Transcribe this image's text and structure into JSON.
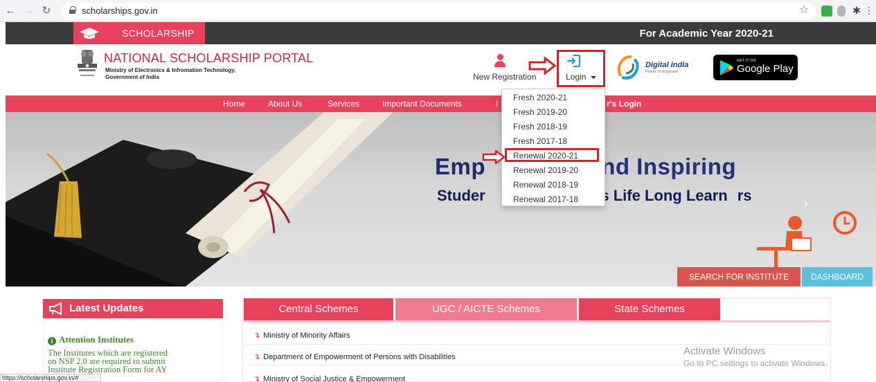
{
  "browser": {
    "url": "scholarships.gov.in",
    "status_url": "https://scholarships.gov.in/#"
  },
  "topbar": {
    "section_label": "SCHOLARSHIP",
    "academic_year": "For Academic Year 2020-21"
  },
  "header": {
    "portal_title": "NATIONAL SCHOLARSHIP PORTAL",
    "ministry_line1": "Ministry of Electronics & Infromation Technology,",
    "ministry_line2": "Government of India",
    "new_registration": "New Registration",
    "login": "Login",
    "digital_india": "Digital India",
    "digital_india_tagline": "Power To Empower",
    "gplay_small": "GET IT ON",
    "gplay_big": "Google Play"
  },
  "nav": {
    "items": [
      "Home",
      "About Us",
      "Services",
      "Important Documents",
      "I",
      "r's Login"
    ]
  },
  "login_dropdown": {
    "items": [
      "Fresh 2020-21",
      "Fresh 2019-20",
      "Fresh 2018-19",
      "Fresh 2017-18",
      "Renewal 2020-21",
      "Renewal 2019-20",
      "Renewal 2018-19",
      "Renewal 2017-18"
    ],
    "highlighted_index": 4
  },
  "hero": {
    "headline_left": "Emp",
    "headline_right": "g and Inspiring",
    "subline_left": "Studer",
    "subline_right": "el as Life Long Learn",
    "subline_end": "rs",
    "search_button": "SEARCH FOR INSTITUTE",
    "dashboard_button": "DASHBOARD"
  },
  "latest_updates": {
    "title": "Latest Updates",
    "attention_title": "Attention Institutes",
    "attention_line1": "The Institutes which are registered",
    "attention_line2": "on NSP 2.0 are required to submit",
    "attention_line3": "Institute Registration Form for AY"
  },
  "schemes": {
    "tabs": [
      "Central Schemes",
      "UGC / AICTE Schemes",
      "State Schemes"
    ],
    "rows": [
      "Ministry of Minority Affairs",
      "Department of Empowerment of Persons with Disabilities",
      "Ministry of Social Justice & Empowerment"
    ]
  },
  "watermark": {
    "title": "Activate Windows",
    "subtitle": "Go to PC settings to activate Windows."
  },
  "colors": {
    "accent": "#e8415b",
    "dark_bar": "#3b3b3b",
    "highlight_border": "#d2222d",
    "search_button": "#d9534f",
    "dashboard_button": "#5bc0de"
  }
}
